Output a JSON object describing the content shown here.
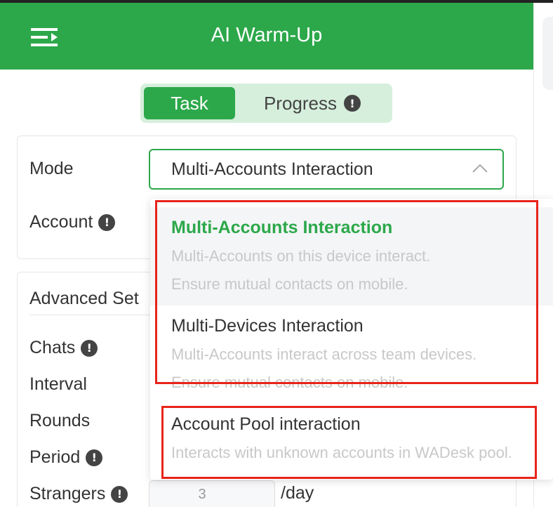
{
  "header": {
    "title": "AI Warm-Up",
    "menu_icon": "menu-collapse-icon",
    "color": "#2ca84a"
  },
  "tabs": [
    {
      "label": "Task",
      "active": true
    },
    {
      "label": "Progress",
      "active": false
    }
  ],
  "info_glyph": "!",
  "form": {
    "mode_label": "Mode",
    "mode_value": "Multi-Accounts Interaction",
    "account_label": "Account"
  },
  "advanced": {
    "title": "Advanced Set",
    "chats_label": "Chats",
    "interval_label": "Interval",
    "rounds_label": "Rounds",
    "period_label": "Period",
    "strangers_label": "Strangers",
    "strangers_value": "3",
    "strangers_unit": "/day"
  },
  "dropdown": {
    "options": [
      {
        "title": "Multi-Accounts Interaction",
        "desc1": "Multi-Accounts on this device interact.",
        "desc2": "Ensure mutual contacts on mobile.",
        "selected": true
      },
      {
        "title": "Multi-Devices Interaction",
        "desc1": "Multi-Accounts interact across team devices.",
        "desc2": "Ensure mutual contacts on mobile.",
        "selected": false
      },
      {
        "title": "Account Pool interaction",
        "desc1": "Interacts with unknown accounts in WADesk pool.",
        "selected": false
      }
    ]
  },
  "colors": {
    "accent": "#2ca84a",
    "accent_light": "#d6efdc",
    "highlight": "#e8231a"
  }
}
